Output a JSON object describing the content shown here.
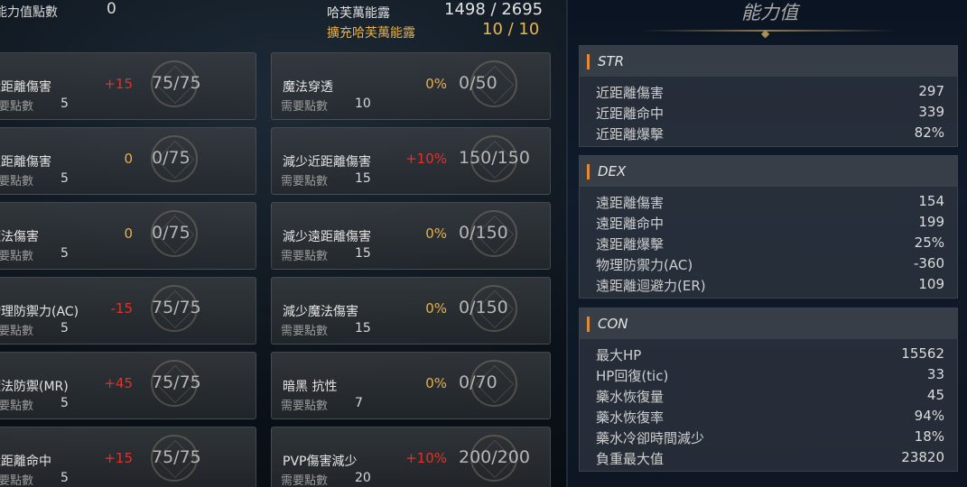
{
  "header": {
    "points_label": "能力值點數",
    "points_value": "0",
    "energy_label": "哈芙萬能露",
    "energy_value": "1498 / 2695",
    "expand_label": "擴充哈芙萬能露",
    "expand_value": "10 / 10"
  },
  "cards_left": [
    {
      "name": "近距離傷害",
      "req_label": "需要點數",
      "req": "5",
      "bonus": "+15",
      "progress": "75/75"
    },
    {
      "name": "遠距離傷害",
      "req_label": "需要點數",
      "req": "5",
      "bonus": "0",
      "progress": "0/75"
    },
    {
      "name": "魔法傷害",
      "req_label": "需要點數",
      "req": "5",
      "bonus": "0",
      "progress": "0/75"
    },
    {
      "name": "物理防禦力(AC)",
      "req_label": "需要點數",
      "req": "5",
      "bonus": "-15",
      "progress": "75/75"
    },
    {
      "name": "魔法防禦(MR)",
      "req_label": "需要點數",
      "req": "5",
      "bonus": "+45",
      "progress": "75/75"
    },
    {
      "name": "近距離命中",
      "req_label": "需要點數",
      "req": "5",
      "bonus": "+15",
      "progress": "75/75"
    }
  ],
  "cards_right": [
    {
      "name": "魔法穿透",
      "req_label": "需要點數",
      "req": "10",
      "bonus": "0%",
      "progress": "0/50"
    },
    {
      "name": "減少近距離傷害",
      "req_label": "需要點數",
      "req": "15",
      "bonus": "+10%",
      "progress": "150/150"
    },
    {
      "name": "減少遠距離傷害",
      "req_label": "需要點數",
      "req": "15",
      "bonus": "0%",
      "progress": "0/150"
    },
    {
      "name": "減少魔法傷害",
      "req_label": "需要點數",
      "req": "15",
      "bonus": "0%",
      "progress": "0/150"
    },
    {
      "name": "暗黑 抗性",
      "req_label": "需要點數",
      "req": "7",
      "bonus": "0%",
      "progress": "0/70"
    },
    {
      "name": "PVP傷害減少",
      "req_label": "需要點數",
      "req": "20",
      "bonus": "+10%",
      "progress": "200/200"
    }
  ],
  "panel": {
    "title": "能力值",
    "sections": [
      {
        "label": "STR",
        "rows": [
          {
            "k": "近距離傷害",
            "v": "297"
          },
          {
            "k": "近距離命中",
            "v": "339"
          },
          {
            "k": "近距離爆擊",
            "v": "82%"
          }
        ]
      },
      {
        "label": "DEX",
        "rows": [
          {
            "k": "遠距離傷害",
            "v": "154"
          },
          {
            "k": "遠距離命中",
            "v": "199"
          },
          {
            "k": "遠距離爆擊",
            "v": "25%"
          },
          {
            "k": "物理防禦力(AC)",
            "v": "-360"
          },
          {
            "k": "遠距離迴避力(ER)",
            "v": "109"
          }
        ]
      },
      {
        "label": "CON",
        "rows": [
          {
            "k": "最大HP",
            "v": "15562"
          },
          {
            "k": "HP回復(tic)",
            "v": "33"
          },
          {
            "k": "藥水恢復量",
            "v": "45"
          },
          {
            "k": "藥水恢復率",
            "v": "94%"
          },
          {
            "k": "藥水冷卻時間減少",
            "v": "18%"
          },
          {
            "k": "負重最大值",
            "v": "23820"
          }
        ]
      }
    ]
  },
  "colors": {
    "bonus_positive": "#e0322a",
    "bonus_neutral": "#e6b04a",
    "section_accent": "#e08a3a"
  }
}
